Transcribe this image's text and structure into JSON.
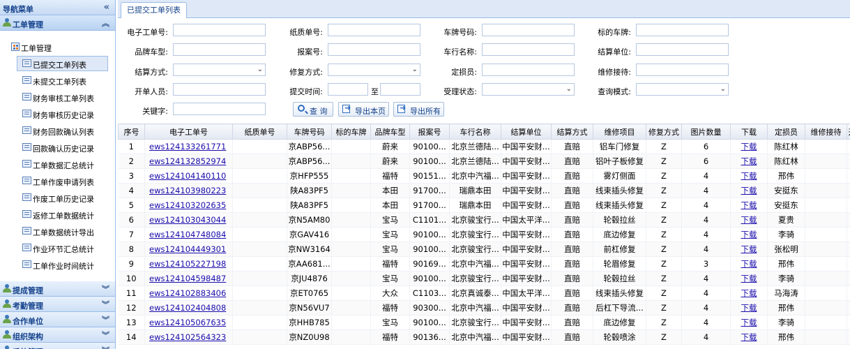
{
  "sidebar": {
    "title": "导航菜单",
    "sections": [
      {
        "label": "工单管理"
      },
      {
        "label": "提成管理"
      },
      {
        "label": "考勤管理"
      },
      {
        "label": "合作单位"
      },
      {
        "label": "组织架构"
      },
      {
        "label": "系统管理"
      }
    ],
    "tree_root": "工单管理",
    "items": [
      {
        "label": "已提交工单列表"
      },
      {
        "label": "未提交工单列表"
      },
      {
        "label": "财务审核工单列表"
      },
      {
        "label": "财务审核历史记录"
      },
      {
        "label": "财务回款确认列表"
      },
      {
        "label": "回款确认历史记录"
      },
      {
        "label": "工单数据汇总统计"
      },
      {
        "label": "工单作废申请列表"
      },
      {
        "label": "作废工单历史记录"
      },
      {
        "label": "返修工单数据统计"
      },
      {
        "label": "工单数据统计导出"
      },
      {
        "label": "作业环节汇总统计"
      },
      {
        "label": "工单作业时间统计"
      }
    ]
  },
  "tab": {
    "label": "已提交工单列表"
  },
  "form": {
    "labels": {
      "e_no": "电子工单号:",
      "paper_no": "纸质单号:",
      "plate": "车牌号码:",
      "std_plate": "标的车牌:",
      "model": "品牌车型:",
      "report_no": "报案号:",
      "company": "车行名称:",
      "settle_unit": "结算单位:",
      "settle_method": "结算方式:",
      "repair_method": "修复方式:",
      "assessor": "定损员:",
      "mechanic": "维修接待:",
      "issuer": "开单人员:",
      "submit_time": "提交时间:",
      "status": "受理状态:",
      "query_mode": "查询模式:",
      "keyword": "关键字:",
      "to": "至"
    },
    "buttons": {
      "search": "查 询",
      "export_page": "导出本页",
      "export_all": "导出所有"
    }
  },
  "table": {
    "columns": [
      "序号",
      "电子工单号",
      "纸质单号",
      "车牌号码",
      "标的车牌",
      "品牌车型",
      "报案号",
      "车行名称",
      "结算单位",
      "结算方式",
      "维修项目",
      "修复方式",
      "图片数量",
      "下载",
      "定损员",
      "维修接待",
      "开"
    ],
    "rows": [
      {
        "no": "1",
        "e_no": "ews124133261771",
        "paper": "",
        "plate": "京ABP56...",
        "std": "",
        "model": "蔚来",
        "report": "90100...",
        "company": "北京兰德陆...",
        "settle": "中国平安财...",
        "method": "直赔",
        "item": "铝车门修复",
        "repair": "Z",
        "pics": "6",
        "dl": "下载",
        "assessor": "陈红林",
        "mech": "",
        "open": ""
      },
      {
        "no": "2",
        "e_no": "ews124132852974",
        "paper": "",
        "plate": "京ABP56...",
        "std": "",
        "model": "蔚来",
        "report": "90100...",
        "company": "北京兰德陆...",
        "settle": "中国平安财...",
        "method": "直赔",
        "item": "铝叶子板修复",
        "repair": "Z",
        "pics": "6",
        "dl": "下载",
        "assessor": "陈红林",
        "mech": "",
        "open": ""
      },
      {
        "no": "3",
        "e_no": "ews124104140110",
        "paper": "",
        "plate": "京HFP555",
        "std": "",
        "model": "福特",
        "report": "90151...",
        "company": "北京中汽福...",
        "settle": "中国平安财...",
        "method": "直赔",
        "item": "雾灯侧面",
        "repair": "Z",
        "pics": "4",
        "dl": "下载",
        "assessor": "邢伟",
        "mech": "",
        "open": ""
      },
      {
        "no": "4",
        "e_no": "ews124103980223",
        "paper": "",
        "plate": "陕A83PF5",
        "std": "",
        "model": "本田",
        "report": "91700...",
        "company": "瑞鼎本田",
        "settle": "中国平安财...",
        "method": "直赔",
        "item": "线束插头修复",
        "repair": "Z",
        "pics": "4",
        "dl": "下载",
        "assessor": "安挺东",
        "mech": "",
        "open": ""
      },
      {
        "no": "5",
        "e_no": "ews124103202635",
        "paper": "",
        "plate": "陕A83PF5",
        "std": "",
        "model": "本田",
        "report": "91700...",
        "company": "瑞鼎本田",
        "settle": "中国平安财...",
        "method": "直赔",
        "item": "线束插头修复",
        "repair": "Z",
        "pics": "4",
        "dl": "下载",
        "assessor": "安挺东",
        "mech": "",
        "open": ""
      },
      {
        "no": "6",
        "e_no": "ews124103043044",
        "paper": "",
        "plate": "京N5AM80",
        "std": "",
        "model": "宝马",
        "report": "C1101...",
        "company": "北京骏宝行...",
        "settle": "中国太平洋...",
        "method": "直赔",
        "item": "轮毂拉丝",
        "repair": "Z",
        "pics": "4",
        "dl": "下载",
        "assessor": "夏贵",
        "mech": "",
        "open": ""
      },
      {
        "no": "7",
        "e_no": "ews124104748084",
        "paper": "",
        "plate": "京GAV416",
        "std": "",
        "model": "宝马",
        "report": "90100...",
        "company": "北京骏宝行...",
        "settle": "中国平安财...",
        "method": "直赔",
        "item": "底边修复",
        "repair": "Z",
        "pics": "4",
        "dl": "下载",
        "assessor": "李骑",
        "mech": "",
        "open": ""
      },
      {
        "no": "8",
        "e_no": "ews124104449301",
        "paper": "",
        "plate": "京NW3164",
        "std": "",
        "model": "宝马",
        "report": "90100...",
        "company": "北京骏宝行...",
        "settle": "中国平安财...",
        "method": "直赔",
        "item": "前杠修复",
        "repair": "Z",
        "pics": "4",
        "dl": "下载",
        "assessor": "张松明",
        "mech": "",
        "open": ""
      },
      {
        "no": "9",
        "e_no": "ews124105227198",
        "paper": "",
        "plate": "京AA681...",
        "std": "",
        "model": "福特",
        "report": "90169...",
        "company": "北京中汽福...",
        "settle": "中国平安财...",
        "method": "直赔",
        "item": "轮眉修复",
        "repair": "Z",
        "pics": "3",
        "dl": "下载",
        "assessor": "邢伟",
        "mech": "",
        "open": ""
      },
      {
        "no": "10",
        "e_no": "ews124104598487",
        "paper": "",
        "plate": "京JU4876",
        "std": "",
        "model": "宝马",
        "report": "90100...",
        "company": "北京骏宝行...",
        "settle": "中国平安财...",
        "method": "直赔",
        "item": "轮毂拉丝",
        "repair": "Z",
        "pics": "4",
        "dl": "下载",
        "assessor": "李骑",
        "mech": "",
        "open": ""
      },
      {
        "no": "11",
        "e_no": "ews124102883406",
        "paper": "",
        "plate": "京ET0765",
        "std": "",
        "model": "大众",
        "report": "C1103...",
        "company": "北京真诚泰...",
        "settle": "中国太平洋...",
        "method": "直赔",
        "item": "线束插头修复",
        "repair": "Z",
        "pics": "4",
        "dl": "下载",
        "assessor": "马海涛",
        "mech": "",
        "open": ""
      },
      {
        "no": "12",
        "e_no": "ews124102404808",
        "paper": "",
        "plate": "京N56VU7",
        "std": "",
        "model": "福特",
        "report": "90300...",
        "company": "北京中汽福...",
        "settle": "中国平安财...",
        "method": "直赔",
        "item": "后杠下导流...",
        "repair": "Z",
        "pics": "4",
        "dl": "下载",
        "assessor": "邢伟",
        "mech": "",
        "open": ""
      },
      {
        "no": "13",
        "e_no": "ews124105067635",
        "paper": "",
        "plate": "京HHB785",
        "std": "",
        "model": "宝马",
        "report": "90100...",
        "company": "北京骏宝行...",
        "settle": "中国平安财...",
        "method": "直赔",
        "item": "底边修复",
        "repair": "Z",
        "pics": "4",
        "dl": "下载",
        "assessor": "李骑",
        "mech": "",
        "open": ""
      },
      {
        "no": "14",
        "e_no": "ews124102564323",
        "paper": "",
        "plate": "京NZ0U98",
        "std": "",
        "model": "福特",
        "report": "90136...",
        "company": "北京中汽福...",
        "settle": "中国平安财...",
        "method": "直赔",
        "item": "轮毂喷涂",
        "repair": "Z",
        "pics": "4",
        "dl": "下载",
        "assessor": "邢伟",
        "mech": "",
        "open": ""
      }
    ]
  }
}
